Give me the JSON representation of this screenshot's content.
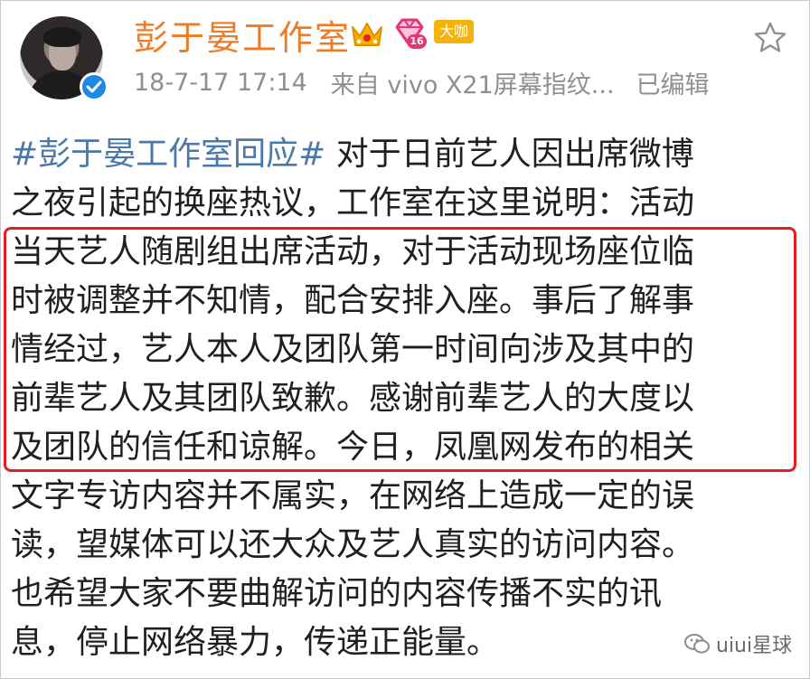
{
  "post": {
    "author": "彭于晏工作室",
    "badge_level": "16",
    "badge_daka": "大咖",
    "date": "18-7-17 17:14",
    "source": "来自 vivo X21屏幕指纹...",
    "edited": "已编辑",
    "topic": "#彭于晏工作室回应#",
    "first_line_rest": " 对于日前艺人因出席微博",
    "lines": [
      "之夜引起的换座热议，工作室在这里说明：活动",
      "当天艺人随剧组出席活动，对于活动现场座位临",
      "时被调整并不知情，配合安排入座。事后了解事",
      "情经过，艺人本人及团队第一时间向涉及其中的",
      "前辈艺人及其团队致歉。感谢前辈艺人的大度以",
      "及团队的信任和谅解。今日，凤凰网发布的相关",
      "文字专访内容并不属实，在网络上造成一定的误",
      "读，望媒体可以还大众及艺人真实的访问内容。",
      "也希望大家不要曲解访问的内容传播不实的讯",
      "息，停止网络暴力，传递正能量。"
    ]
  },
  "watermark": "uiui星球",
  "colors": {
    "name": "#ee7b26",
    "topic": "#4c78a8",
    "highlight_border": "#e02020",
    "verified": "#1e88e5"
  }
}
